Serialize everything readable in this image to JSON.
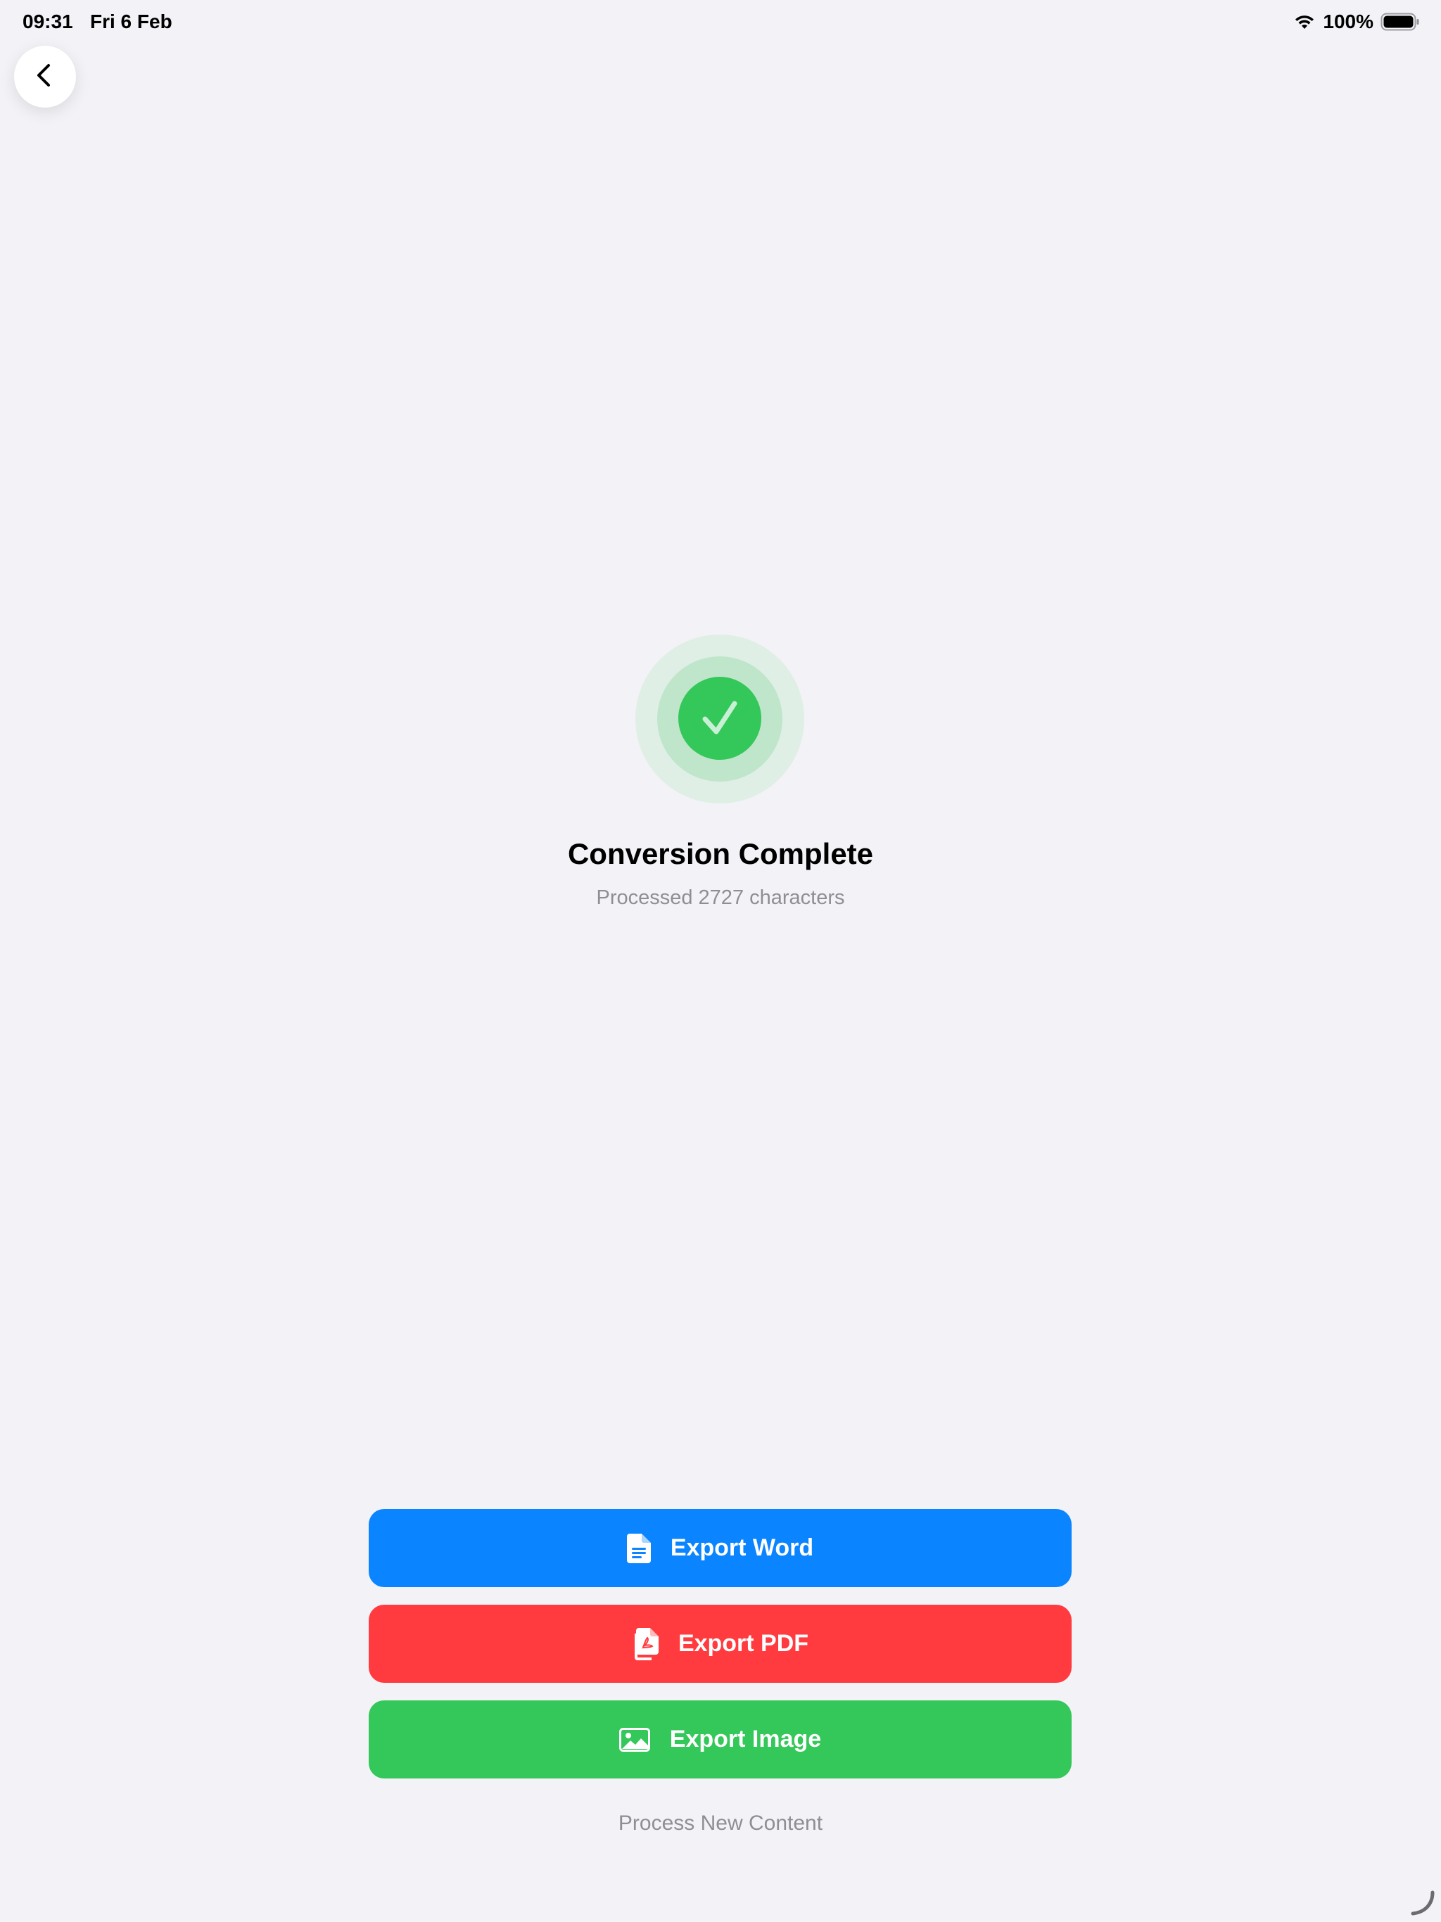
{
  "status_bar": {
    "time": "09:31",
    "date": "Fri 6 Feb",
    "battery": "100%",
    "wifi_icon": "wifi-icon",
    "battery_icon": "battery-full-icon"
  },
  "navigation": {
    "back_icon": "chevron-left-icon"
  },
  "result": {
    "icon": "checkmark-circle-icon",
    "title": "Conversion Complete",
    "subtitle": "Processed 2727 characters"
  },
  "actions": {
    "export_word": {
      "label": "Export Word",
      "icon": "document-icon",
      "color": "#0a84ff"
    },
    "export_pdf": {
      "label": "Export PDF",
      "icon": "pdf-document-icon",
      "color": "#ff3b3f"
    },
    "export_image": {
      "label": "Export Image",
      "icon": "image-icon",
      "color": "#34c759"
    },
    "process_new": "Process New Content"
  },
  "colors": {
    "background": "#f2f2f7",
    "success": "#34c759",
    "secondary_text": "#8e8e93"
  }
}
